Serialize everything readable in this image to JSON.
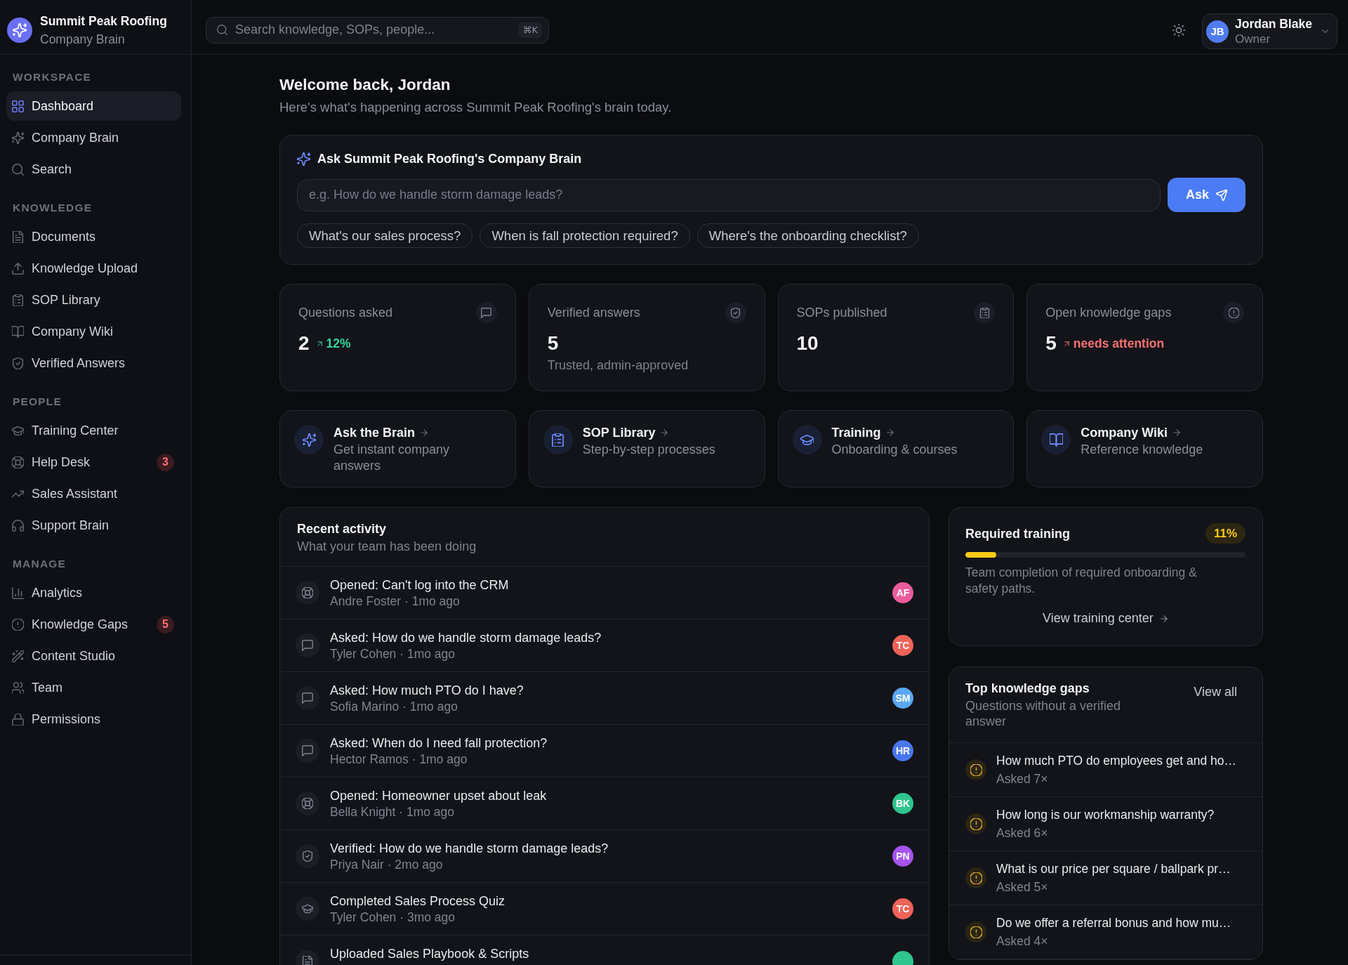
{
  "sidebar": {
    "brand": {
      "name": "Summit Peak Roofing",
      "subtitle": "Company Brain"
    },
    "sections": [
      {
        "label": "WORKSPACE",
        "items": [
          {
            "label": "Dashboard",
            "selected": true
          },
          {
            "label": "Company Brain",
            "selected": false
          },
          {
            "label": "Search",
            "selected": false
          }
        ]
      },
      {
        "label": "KNOWLEDGE",
        "items": [
          {
            "label": "Documents",
            "selected": false
          },
          {
            "label": "Knowledge Upload",
            "selected": false
          },
          {
            "label": "SOP Library",
            "selected": false
          },
          {
            "label": "Company Wiki",
            "selected": false
          },
          {
            "label": "Verified Answers",
            "selected": false
          }
        ]
      },
      {
        "label": "PEOPLE",
        "items": [
          {
            "label": "Training Center",
            "selected": false
          },
          {
            "label": "Help Desk",
            "selected": false,
            "badge": "3"
          },
          {
            "label": "Sales Assistant",
            "selected": false
          },
          {
            "label": "Support Brain",
            "selected": false
          }
        ]
      },
      {
        "label": "MANAGE",
        "items": [
          {
            "label": "Analytics",
            "selected": false
          },
          {
            "label": "Knowledge Gaps",
            "selected": false,
            "badge": "5"
          },
          {
            "label": "Content Studio",
            "selected": false
          },
          {
            "label": "Team",
            "selected": false
          },
          {
            "label": "Permissions",
            "selected": false
          }
        ]
      }
    ]
  },
  "top_bar": {
    "search": {
      "placeholder": "Search knowledge, SOPs, people...",
      "shortcut": "⌘K"
    },
    "user": {
      "initials": "JB",
      "name": "Jordan Blake",
      "role": "Owner"
    }
  },
  "welcome": {
    "title": "Welcome back, Jordan",
    "subtitle": "Here's what's happening across Summit Peak Roofing's brain today."
  },
  "ask": {
    "title": "Ask Summit Peak Roofing's Company Brain",
    "placeholder": "e.g. How do we handle storm damage leads?",
    "button": "Ask",
    "suggestions": [
      "What's our sales process?",
      "When is fall protection required?",
      "Where's the onboarding checklist?"
    ]
  },
  "stats": [
    {
      "label": "Questions asked",
      "value": "2",
      "trend": {
        "text": "12%",
        "color": "#34d399"
      }
    },
    {
      "label": "Verified answers",
      "value": "5",
      "note": "Trusted, admin-approved"
    },
    {
      "label": "SOPs published",
      "value": "10"
    },
    {
      "label": "Open knowledge gaps",
      "value": "5",
      "trend": {
        "text": "needs attention",
        "color": "#f87171"
      }
    }
  ],
  "shortcuts": [
    {
      "title": "Ask the Brain",
      "description": "Get instant company answers"
    },
    {
      "title": "SOP Library",
      "description": "Step-by-step processes"
    },
    {
      "title": "Training",
      "description": "Onboarding & courses"
    },
    {
      "title": "Company Wiki",
      "description": "Reference knowledge"
    }
  ],
  "recent_activity": {
    "title": "Recent activity",
    "subtitle": "What your team has been doing",
    "items": [
      {
        "kind": "ticket",
        "title": "Opened: Can't log into the CRM",
        "meta": "Andre Foster · 1mo ago",
        "initials": "AF",
        "color": "#ec5b9c"
      },
      {
        "kind": "question",
        "title": "Asked: How do we handle storm damage leads?",
        "meta": "Tyler Cohen · 1mo ago",
        "initials": "TC",
        "color": "#ef6358"
      },
      {
        "kind": "question",
        "title": "Asked: How much PTO do I have?",
        "meta": "Sofia Marino · 1mo ago",
        "initials": "SM",
        "color": "#5aa7f5"
      },
      {
        "kind": "question",
        "title": "Asked: When do I need fall protection?",
        "meta": "Hector Ramos · 1mo ago",
        "initials": "HR",
        "color": "#4776ee"
      },
      {
        "kind": "ticket",
        "title": "Opened: Homeowner upset about leak",
        "meta": "Bella Knight · 1mo ago",
        "initials": "BK",
        "color": "#2fc58e"
      },
      {
        "kind": "verification",
        "title": "Verified: How do we handle storm damage leads?",
        "meta": "Priya Nair · 2mo ago",
        "initials": "PN",
        "color": "#a653f0"
      },
      {
        "kind": "training",
        "title": "Completed Sales Process Quiz",
        "meta": "Tyler Cohen · 3mo ago",
        "initials": "TC",
        "color": "#ef6358"
      },
      {
        "kind": "upload",
        "title": "Uploaded Sales Playbook & Scripts",
        "color": "#2fc58e"
      }
    ]
  },
  "required_training": {
    "title": "Required training",
    "percent": "11%",
    "level": 0.11,
    "description": "Team completion of required onboarding & safety paths.",
    "link": "View training center"
  },
  "knowledge_gaps": {
    "title": "Top knowledge gaps",
    "subtitle": "Questions without a verified answer",
    "action": "View all",
    "items": [
      {
        "question": "How much PTO do employees get and ho…",
        "count": "Asked 7×"
      },
      {
        "question": "How long is our workmanship warranty?",
        "count": "Asked 6×"
      },
      {
        "question": "What is our price per square / ballpark pr…",
        "count": "Asked 5×"
      },
      {
        "question": "Do we offer a referral bonus and how mu…",
        "count": "Asked 4×"
      }
    ]
  }
}
